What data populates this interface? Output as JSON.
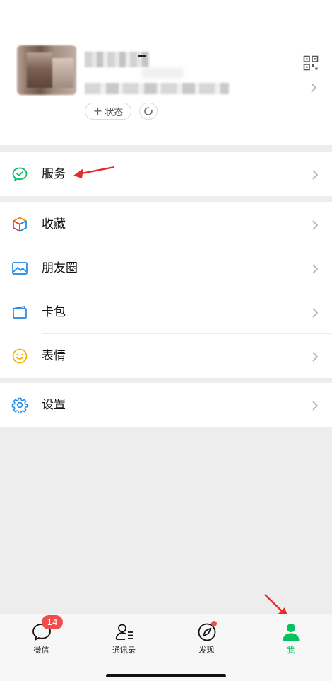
{
  "profile": {
    "status_label": "状态",
    "icons": {
      "qr": "qr-code-icon",
      "arrow": "chevron-right-icon",
      "refresh": "refresh-circle-icon"
    }
  },
  "menu": {
    "services": {
      "label": "服务",
      "icon": "wechat-pay-icon",
      "icon_color": "#07c160"
    },
    "favorites": {
      "label": "收藏",
      "icon": "cube-icon"
    },
    "moments": {
      "label": "朋友圈",
      "icon": "picture-icon",
      "icon_color": "#1e88e5"
    },
    "cards": {
      "label": "卡包",
      "icon": "card-wallet-icon",
      "icon_color": "#1e88e5"
    },
    "stickers": {
      "label": "表情",
      "icon": "smiley-icon",
      "icon_color": "#f5b400"
    },
    "settings": {
      "label": "设置",
      "icon": "gear-icon",
      "icon_color": "#1e88e5"
    }
  },
  "tabbar": {
    "tabs": [
      {
        "label": "微信",
        "icon": "chat-bubble-icon",
        "badge": "14"
      },
      {
        "label": "通讯录",
        "icon": "contacts-icon"
      },
      {
        "label": "发现",
        "icon": "compass-icon",
        "has_dot": true
      },
      {
        "label": "我",
        "icon": "person-icon",
        "active": true
      }
    ],
    "active_color": "#07c160",
    "badge_color": "#f44c4c"
  }
}
